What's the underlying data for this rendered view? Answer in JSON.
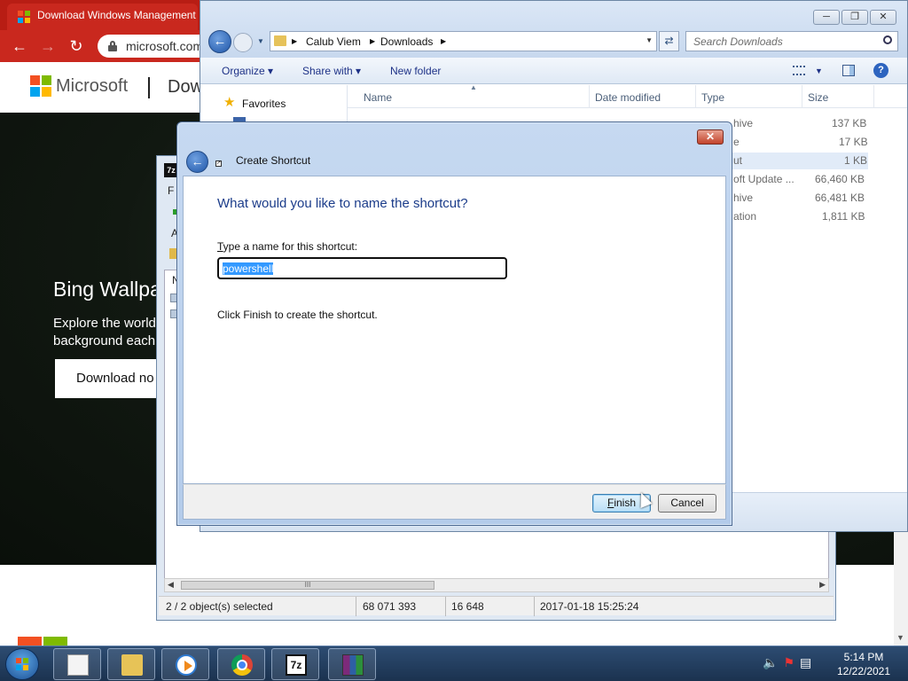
{
  "browser": {
    "tab_title": "Download Windows Management",
    "url": "microsoft.com",
    "brand": "Microsoft",
    "page_title": "Dow",
    "hero_title": "Bing Wallpa",
    "hero_text": "Explore the world background each",
    "hero_button": "Download no"
  },
  "zip": {
    "app_icon": "7z",
    "menu_letter": "F",
    "toolbar_letter": "A",
    "col_name": "N",
    "scroll_grip": "III",
    "status": {
      "selected": "2 / 2 object(s) selected",
      "size": "68 071 393",
      "packed": "16 648",
      "modified": "2017-01-18 15:25:24"
    }
  },
  "explorer": {
    "breadcrumb": [
      "Calub Viem",
      "Downloads"
    ],
    "search_placeholder": "Search Downloads",
    "commands": {
      "organize": "Organize",
      "share_with": "Share with",
      "new_folder": "New folder"
    },
    "nav": {
      "favorites": "Favorites"
    },
    "columns": {
      "name": "Name",
      "date": "Date modified",
      "type": "Type",
      "size": "Size"
    },
    "rows": [
      {
        "type": "hive",
        "size": "137 KB"
      },
      {
        "type": "e",
        "size": "17 KB"
      },
      {
        "type": "ut",
        "size": "1 KB"
      },
      {
        "type": "oft Update ...",
        "size": "66,460 KB"
      },
      {
        "type": "hive",
        "size": "66,481 KB"
      },
      {
        "type": "ation",
        "size": "1,811 KB"
      }
    ]
  },
  "wizard": {
    "title": "Create Shortcut",
    "heading": "What would you like to name the shortcut?",
    "label_prefix": "T",
    "label_rest": "ype a name for this shortcut:",
    "name_value": "powershell",
    "hint": "Click Finish to create the shortcut.",
    "finish_prefix": "F",
    "finish_rest": "inish",
    "cancel": "Cancel"
  },
  "taskbar": {
    "zip_label": "7z",
    "time": "5:14 PM",
    "date": "12/22/2021"
  }
}
